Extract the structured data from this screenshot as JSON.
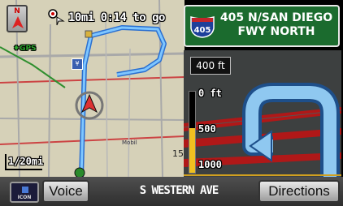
{
  "colors": {
    "map_background": "#d6d1b8",
    "route": "#3aa0ff",
    "freeway_sign": "#1b6b2e",
    "junction_bg": "#3a3c3b",
    "distance_bar": "#f0c020"
  },
  "map": {
    "north_label": "N",
    "trip_info": "10mi 0:14 to go",
    "gps_label": "GPS",
    "scale_label": "1/20mi",
    "map_labels": {
      "poi_a": "Mobil",
      "edge_number": "15"
    },
    "icons": [
      "north-arrow-icon",
      "destination-flag-icon",
      "atm-icon",
      "vehicle-position-icon",
      "waypoint-icon",
      "gas-station-icon"
    ]
  },
  "sign": {
    "shield_number": "405",
    "line1": "405 N/SAN DIEGO",
    "line2": "FWY NORTH"
  },
  "junction": {
    "distance_to_turn": "400 ft",
    "ticks": [
      "0 ft",
      "500",
      "1000"
    ],
    "bar_fraction": 0.55
  },
  "bottom": {
    "icon_button_label": "ICON",
    "voice_label": "Voice",
    "street_name": "S WESTERN AVE",
    "directions_label": "Directions"
  }
}
